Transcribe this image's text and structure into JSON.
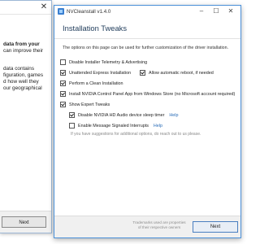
{
  "back_window": {
    "lines": [
      {
        "text": "data from your",
        "bold": true
      },
      {
        "text": "can improve their",
        "bold": false
      },
      {
        "text": "",
        "bold": false
      },
      {
        "text": "data contains",
        "bold": false
      },
      {
        "text": "figuration, games",
        "bold": false
      },
      {
        "text": "d how well they",
        "bold": false
      },
      {
        "text": "our geographical",
        "bold": false
      }
    ],
    "next_label": "Next"
  },
  "window": {
    "title": "NVCleanstall v1.4.0",
    "heading": "Installation Tweaks",
    "intro": "The options on this page can be used for further customization of the driver installation.",
    "options": {
      "telemetry": {
        "label": "Disable Installer Telemetry & Advertising",
        "checked": false
      },
      "unattended": {
        "label": "Unattended Express Installation",
        "checked": true
      },
      "reboot": {
        "label": "Allow automatic reboot, if needed",
        "checked": true
      },
      "clean": {
        "label": "Perform a Clean Installation",
        "checked": true
      },
      "control_panel": {
        "label": "Install NVIDIA Control Panel App from Windows Store (no Microsoft account required)",
        "checked": true
      },
      "expert": {
        "label": "Show Expert Tweaks",
        "checked": true
      },
      "hd_audio": {
        "label": "Disable NVIDIA HD Audio device sleep timer",
        "checked": true,
        "help": "Help"
      },
      "msi": {
        "label": "Enable Message Signaled Interrupts",
        "checked": false,
        "help": "Help"
      }
    },
    "hint": "If you have suggestions for additional options, do reach out to us please.",
    "trademark": "Trademarks used are properties of their respective owners",
    "next_label": "Next"
  }
}
